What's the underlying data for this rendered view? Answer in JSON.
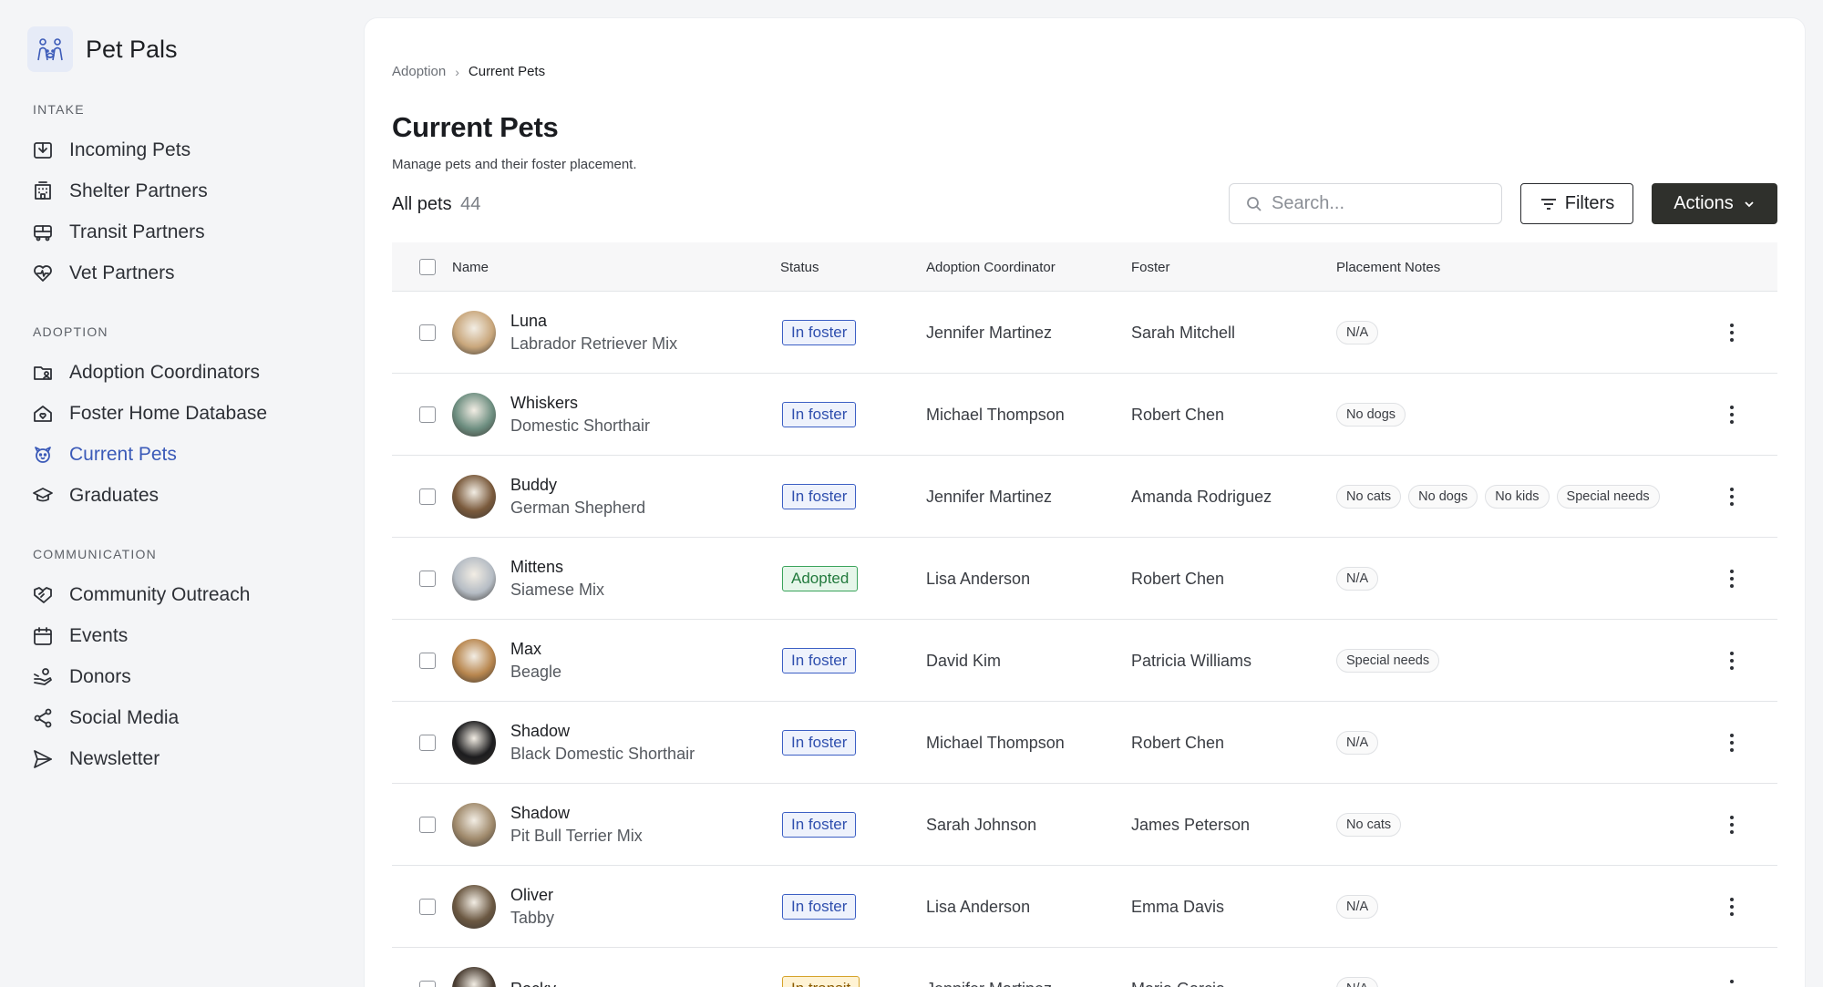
{
  "brand": {
    "name": "Pet Pals",
    "icon": "paw-people-logo-icon"
  },
  "sidebar": {
    "sections": [
      {
        "heading": "INTAKE",
        "items": [
          {
            "label": "Incoming Pets",
            "icon": "inbox-icon",
            "active": false
          },
          {
            "label": "Shelter Partners",
            "icon": "building-icon",
            "active": false
          },
          {
            "label": "Transit Partners",
            "icon": "bus-icon",
            "active": false
          },
          {
            "label": "Vet Partners",
            "icon": "heart-pulse-icon",
            "active": false
          }
        ]
      },
      {
        "heading": "ADOPTION",
        "items": [
          {
            "label": "Adoption Coordinators",
            "icon": "folder-user-icon",
            "active": false
          },
          {
            "label": "Foster Home Database",
            "icon": "home-heart-icon",
            "active": false
          },
          {
            "label": "Current Pets",
            "icon": "pet-face-icon",
            "active": true
          },
          {
            "label": "Graduates",
            "icon": "graduation-cap-icon",
            "active": false
          }
        ]
      },
      {
        "heading": "COMMUNICATION",
        "items": [
          {
            "label": "Community Outreach",
            "icon": "handshake-icon",
            "active": false
          },
          {
            "label": "Events",
            "icon": "calendar-icon",
            "active": false
          },
          {
            "label": "Donors",
            "icon": "hand-coins-icon",
            "active": false
          },
          {
            "label": "Social Media",
            "icon": "share-icon",
            "active": false
          },
          {
            "label": "Newsletter",
            "icon": "send-icon",
            "active": false
          }
        ]
      }
    ]
  },
  "breadcrumb": {
    "parent": "Adoption",
    "separator": "›",
    "current": "Current Pets"
  },
  "page": {
    "title": "Current Pets",
    "subtitle": "Manage pets and their foster placement."
  },
  "toolbar": {
    "count_label": "All pets",
    "count_value": "44",
    "search_placeholder": "Search...",
    "filters_label": "Filters",
    "actions_label": "Actions"
  },
  "table": {
    "columns": {
      "name": "Name",
      "status": "Status",
      "coordinator": "Adoption Coordinator",
      "foster": "Foster",
      "notes": "Placement Notes"
    },
    "rows": [
      {
        "name": "Luna",
        "breed": "Labrador Retriever Mix",
        "status": "In foster",
        "status_kind": "foster",
        "coordinator": "Jennifer Martinez",
        "foster": "Sarah Mitchell",
        "notes": [
          "N/A"
        ],
        "avatar_color": "#c9a77c"
      },
      {
        "name": "Whiskers",
        "breed": "Domestic Shorthair",
        "status": "In foster",
        "status_kind": "foster",
        "coordinator": "Michael Thompson",
        "foster": "Robert Chen",
        "notes": [
          "No dogs"
        ],
        "avatar_color": "#6d8e80"
      },
      {
        "name": "Buddy",
        "breed": "German Shepherd",
        "status": "In foster",
        "status_kind": "foster",
        "coordinator": "Jennifer Martinez",
        "foster": "Amanda Rodriguez",
        "notes": [
          "No cats",
          "No dogs",
          "No kids",
          "Special needs"
        ],
        "avatar_color": "#7a5a3c"
      },
      {
        "name": "Mittens",
        "breed": "Siamese Mix",
        "status": "Adopted",
        "status_kind": "adopted",
        "coordinator": "Lisa Anderson",
        "foster": "Robert Chen",
        "notes": [
          "N/A"
        ],
        "avatar_color": "#b5bcc4"
      },
      {
        "name": "Max",
        "breed": "Beagle",
        "status": "In foster",
        "status_kind": "foster",
        "coordinator": "David Kim",
        "foster": "Patricia Williams",
        "notes": [
          "Special needs"
        ],
        "avatar_color": "#b8864e"
      },
      {
        "name": "Shadow",
        "breed": "Black Domestic Shorthair",
        "status": "In foster",
        "status_kind": "foster",
        "coordinator": "Michael Thompson",
        "foster": "Robert Chen",
        "notes": [
          "N/A"
        ],
        "avatar_color": "#1c1c1e"
      },
      {
        "name": "Shadow",
        "breed": "Pit Bull Terrier Mix",
        "status": "In foster",
        "status_kind": "foster",
        "coordinator": "Sarah Johnson",
        "foster": "James Peterson",
        "notes": [
          "No cats"
        ],
        "avatar_color": "#a08a6c"
      },
      {
        "name": "Oliver",
        "breed": "Tabby",
        "status": "In foster",
        "status_kind": "foster",
        "coordinator": "Lisa Anderson",
        "foster": "Emma Davis",
        "notes": [
          "N/A"
        ],
        "avatar_color": "#6b5842"
      },
      {
        "name": "Rocky",
        "breed": "",
        "status": "In transit",
        "status_kind": "transit",
        "coordinator": "Jennifer Martinez",
        "foster": "Maria Garcia",
        "notes": [
          "N/A"
        ],
        "avatar_color": "#4a3d32"
      }
    ]
  },
  "colors": {
    "accent": "#3b5ab8",
    "foster_badge": "#3c5fc4",
    "adopted_badge": "#3aa35a",
    "actions_button": "#2f302c"
  }
}
